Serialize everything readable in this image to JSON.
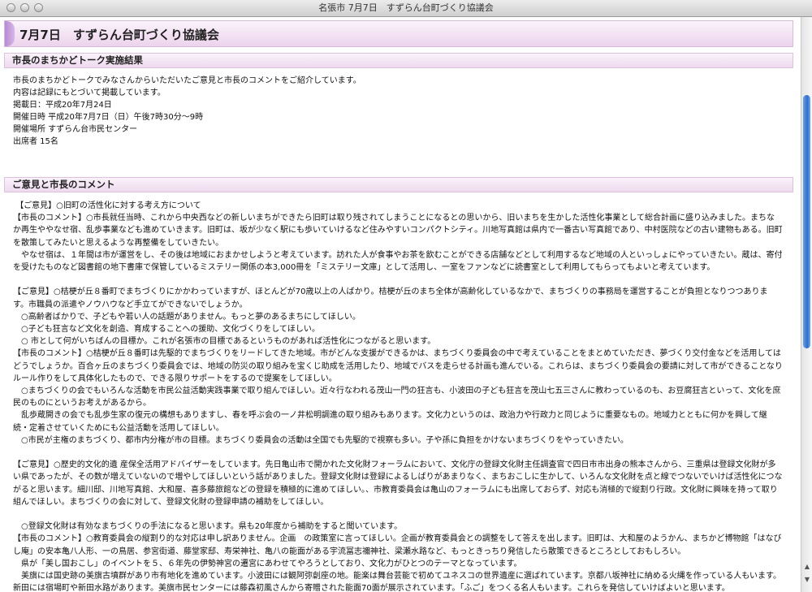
{
  "window": {
    "title": "名張市 7月7日　すずらん台町づくり協議会"
  },
  "page": {
    "title": "7月7日　すずらん台町づくり協議会"
  },
  "section1": {
    "heading": "市長のまちかどトーク実施結果",
    "lines": [
      "市長のまちかどトークでみなさんからいただいたご意見と市長のコメントをご紹介しています。",
      "内容は記録にもとづいて掲載しています。",
      "掲載日：平成20年7月24日",
      "開催日時 平成20年7月7日（日）午後7時30分～9時",
      "開催場所 すずらん台市民センター",
      "出席者 15名"
    ]
  },
  "section2": {
    "heading": "ご意見と市長のコメント",
    "paragraphs": [
      " 【ご意見】○旧町の活性化に対する考え方について",
      "【市長のコメント】○市長就任当時、これから中央西などの新しいまちができたら旧町は取り残されてしまうことになるとの思いから、旧いまちを生かした活性化事業として総合計画に盛り込みました。まちなか再生ややなせ宿、乱歩事業なども進めていきます。旧町は、坂が少なく駅にも歩いていけるなど住みやすいコンパクトシティ。川地写真館は県内で一番古い写真館であり、中村医院などの古い建物もある。旧町を散策してみたいと思えるような再整備をしていきたい。",
      "　やなせ宿は、１年間は市が運営をし、その後は地域におまかせしようと考えています。訪れた人が食事やお茶を飲むことができる店舗などとして利用するなど地域の人といっしょにやっていきたい。蔵は、寄付を受けたものなど図書館の地下書庫で保管しているミステリー関係の本3,000冊を「ミステリー文庫」として活用し、一室をファンなどに読書室として利用してもらってもよいと考えています。",
      "",
      "【ご意見】○桔梗が丘８番町でまちづくりにかかわっていますが、ほとんどが70歳以上の人ばかり。桔梗が丘のまち全体が高齢化しているなかで、まちづくりの事務局を運営することが負担となりつつあります。市職員の派遣やノウハウなど手立てができないでしょうか。",
      "　○高齢者ばかりで、子どもや若い人の話題がありません。もっと夢のあるまちにしてほしい。",
      "　○子ども狂言など文化を創造、育成することへの援助、文化づくりをしてほしい。",
      "　○ 市として何がいちばんの目標か。これが名張市の目標であるというものがあれば活性化につながると思います。",
      "【市長のコメント】○桔梗が丘８番町は先駆的でまちづくりをリードしてきた地域。市がどんな支援ができるかは、まちづくり委員会の中で考えていることをまとめていただき、夢づくり交付金などを活用してはどうでしょうか。百合ヶ丘のまちづくり委員会では、地域の防災の取り組みを宝くじ助成を活用したり、地域でバスを走らせる計画も進んでいる。これらは、まちづくり委員会の要請に対して市ができることなりルール作りをして具体化したもので、できる限りサポートをするので提案をしてほしい。",
      "　○まちづくりの会でもいろんな活動を市民公益活動実践事業で取り組んでほしい。近々行なわれる茂山一門の狂言も、小波田の子ども狂言を茂山七五三さんに教わっているのも、お豆腐狂言といって、文化を庶民のものにというお考えがあるから。",
      "　乱歩蔵開きの会でも乱歩生家の復元の構想もありますし、春を呼ぶ会の一ノ井松明調進の取り組みもあります。文化力というのは、政治力や行政力と同じように重要なもの。地域力とともに何かを興して継続・定着させていくためにも公益活動を活用してほしい。",
      "　○市民が主権のまちづくり、都市内分権が市の目標。まちづくり委員会の活動は全国でも先駆的で視察も多い。子や孫に負担をかけないまちづくりをやっていきたい。",
      "",
      "【ご意見】○歴史的文化的遺 産保全活用アドバイザーをしています。先日亀山市で開かれた文化財フォーラムにおいて、文化庁の登録文化財主任調査官で四日市市出身の熊本さんから、三重県は登録文化財が多い県であったが、その数が増えていないので増やしてほしいという話がありました。登録文化財は登録によるしばりがあまりなく、まちおこしに生かして、いろんな文化財を点と線でつないでいけば活性化につながると思います。細川邸、川地写真館、大和屋、喜多藤旅館などの登録を積極的に進めてほしい。、市教育委員会は亀山のフォーラムにも出席しておらず、対応も消極的で縦割り行政。文化財に興味を持って取り組んでほしい。まちづくりの会に対して、登録文化財の登録申請の補助をしてほしい。",
      "",
      "　○登録文化財は有効なまちづくりの手法になると思います。県も20年度から補助をすると聞いています。",
      "【市長のコメント】○教育委員会の縦割り的な対応は申し訳ありません。企画　の政策室に言ってほしい。企画が教育委員会との調整をして答えを出します。旧町は、大和屋のようかん、まちかど博物館「はなびし庵」の安本亀八人形、一の鳥居、参宮街道、藤堂家邸、寿栄神社、亀八の能面がある宇流冨志禰神社、梁瀬水路など、もっときっちり発信したら散策できるところとしておもしろい。",
      "　県が「美し国おこし」のイベントを５、６年先の伊勢神宮の遷宮にあわせてやろうとしており、文化力がひとつのテーマとなっています。",
      "　美旗には国史跡の美旗古墳群があり市有地化を進めています。小波田には観阿弥創座の地。能楽は舞台芸能で初めてユネスコの世界遺産に選ばれています。京都八坂神社に納める火縄を作っている人もいます。新田には宿場町や新田水路があります。美旗市民センターには藤森初風さんから寄贈された能面70面が展示されています。「ふご」をつくる名人もいます。これらを発信していけばよいと思います。"
    ]
  }
}
